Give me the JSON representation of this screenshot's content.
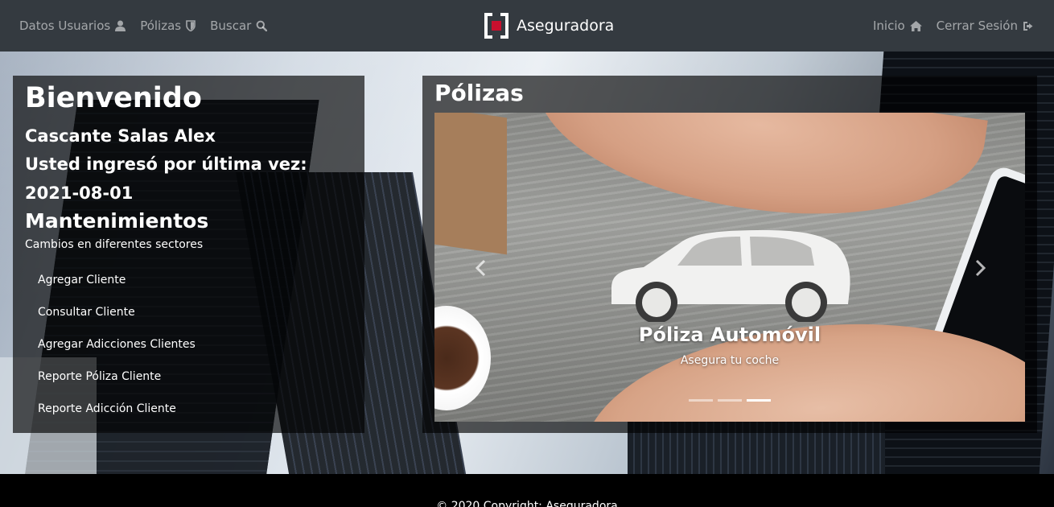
{
  "navbar": {
    "links_left": [
      {
        "label": "Datos Usuarios",
        "icon": "user-icon"
      },
      {
        "label": "Pólizas",
        "icon": "shield-icon"
      },
      {
        "label": "Buscar",
        "icon": "search-icon"
      }
    ],
    "brand": "Aseguradora",
    "links_right": [
      {
        "label": "Inicio",
        "icon": "home-icon"
      },
      {
        "label": "Cerrar Sesión",
        "icon": "sign-out-icon"
      }
    ]
  },
  "welcome_panel": {
    "title": "Bienvenido",
    "user_name": "Cascante Salas Alex",
    "last_login": "Usted ingresó por última vez: 2021-08-01",
    "maintenance_title": "Mantenimientos",
    "maintenance_subtitle": "Cambios en diferentes sectores",
    "menu_items": [
      "Agregar Cliente",
      "Consultar Cliente",
      "Agregar Adicciones Clientes",
      "Reporte Póliza Cliente",
      "Reporte Adicción Cliente"
    ]
  },
  "policies_panel": {
    "title": "Pólizas",
    "slide": {
      "title": "Póliza Automóvil",
      "subtitle": "Asegura tu coche"
    },
    "indicator_count": 3,
    "active_indicator": 3
  },
  "footer": {
    "text": "© 2020 Copyright: Aseguradora"
  },
  "colors": {
    "navbar_bg": "#343a40",
    "logo_red": "#c8102e",
    "panel_bg": "rgba(0,0,0,0.65)",
    "footer_bg": "#000000"
  }
}
